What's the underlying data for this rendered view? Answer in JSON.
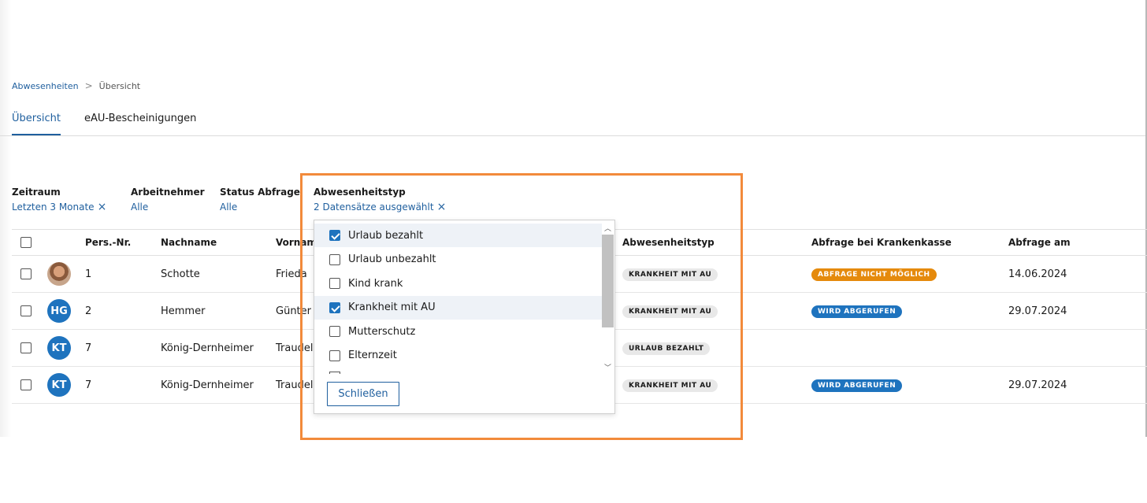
{
  "breadcrumb": {
    "parent": "Abwesenheiten",
    "separator": ">",
    "current": "Übersicht"
  },
  "tabs": [
    {
      "label": "Übersicht",
      "active": true
    },
    {
      "label": "eAU-Bescheinigungen",
      "active": false
    }
  ],
  "filters": {
    "zeitraum": {
      "label": "Zeitraum",
      "value": "Letzten 3 Monate"
    },
    "arbeitnehmer": {
      "label": "Arbeitnehmer",
      "value": "Alle"
    },
    "status": {
      "label": "Status Abfrage",
      "value": "Alle"
    },
    "abwesenheitstyp": {
      "label": "Abwesenheitstyp",
      "value": "2 Datensätze ausgewählt"
    }
  },
  "table": {
    "headers": {
      "pers": "Pers.-Nr.",
      "nachname": "Nachname",
      "vorname": "Vorname",
      "abwesenheitstyp": "Abwesenheitstyp",
      "abfrage": "Abfrage bei Krankenkasse",
      "abfrage_am": "Abfrage am"
    },
    "rows": [
      {
        "avatar": "",
        "avatar_type": "photo",
        "pers": "1",
        "nachname": "Schotte",
        "vorname": "Frieda",
        "typ": "KRANKHEIT MIT AU",
        "abfrage": "ABFRAGE NICHT MÖGLICH",
        "abfrage_color": "orange",
        "abfrage_am": "14.06.2024"
      },
      {
        "avatar": "HG",
        "avatar_type": "initials",
        "pers": "2",
        "nachname": "Hemmer",
        "vorname": "Günter",
        "typ": "KRANKHEIT MIT AU",
        "abfrage": "WIRD ABGERUFEN",
        "abfrage_color": "blue",
        "abfrage_am": "29.07.2024"
      },
      {
        "avatar": "KT",
        "avatar_type": "initials",
        "pers": "7",
        "nachname": "König-Dernheimer",
        "vorname": "Traudel",
        "typ": "URLAUB BEZAHLT",
        "abfrage": "",
        "abfrage_color": "",
        "abfrage_am": ""
      },
      {
        "avatar": "KT",
        "avatar_type": "initials",
        "pers": "7",
        "nachname": "König-Dernheimer",
        "vorname": "Traudel",
        "typ": "KRANKHEIT MIT AU",
        "abfrage": "WIRD ABGERUFEN",
        "abfrage_color": "blue",
        "abfrage_am": "29.07.2024"
      }
    ]
  },
  "dropdown": {
    "options": [
      {
        "label": "Urlaub bezahlt",
        "checked": true
      },
      {
        "label": "Urlaub unbezahlt",
        "checked": false
      },
      {
        "label": "Kind krank",
        "checked": false
      },
      {
        "label": "Krankheit mit AU",
        "checked": true
      },
      {
        "label": "Mutterschutz",
        "checked": false
      },
      {
        "label": "Elternzeit",
        "checked": false
      }
    ],
    "close_label": "Schließen"
  },
  "colors": {
    "accent": "#1f5f9e",
    "highlight": "#f28a3b",
    "badge_orange": "#e58a0c",
    "badge_blue": "#1e73be"
  },
  "icons": {
    "clear": "close-icon",
    "breadcrumb_sep": "chevron-right-icon",
    "scroll_up": "chevron-up-icon",
    "scroll_down": "chevron-down-icon",
    "check": "checkmark-icon"
  }
}
